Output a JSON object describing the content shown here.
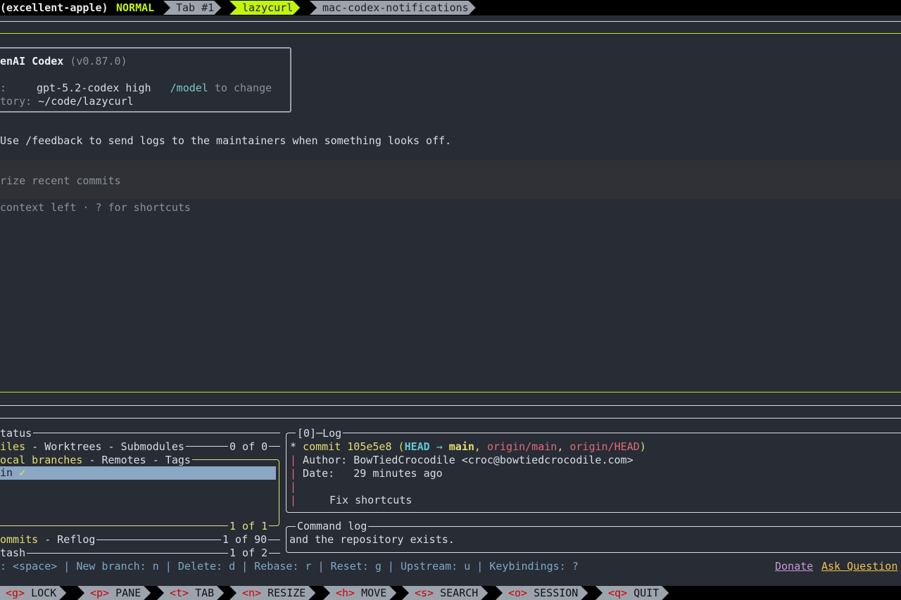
{
  "topbar": {
    "session": "(excellent-apple)",
    "mode": "NORMAL",
    "tabs": [
      {
        "label": "Tab #1",
        "active": false
      },
      {
        "label": "lazycurl",
        "active": true
      },
      {
        "label": "mac-codex-notifications",
        "active": false
      }
    ]
  },
  "codex": {
    "title": "enAI Codex",
    "version": "(v0.87.0)",
    "model_key": ":",
    "model_value": "gpt-5.2-codex high",
    "model_cmd": "/model",
    "model_hint": "to change",
    "dir_key": "tory:",
    "dir_value": "~/code/lazycurl",
    "tip": "Use /feedback to send logs to the maintainers when something looks off.",
    "prompt_placeholder": "rize recent commits",
    "footer": "context left · ? for shortcuts"
  },
  "lazygit": {
    "status_title": "tatus",
    "files_tabs": {
      "active": "iles",
      "rest": " - Worktrees - Submodules"
    },
    "files_count": "0 of 0",
    "branches_tabs": {
      "active": "ocal branches",
      "rest": " - Remotes - Tags"
    },
    "branch_item": "in",
    "branch_check": "✓",
    "branches_count": "1 of 1",
    "commits_tabs": {
      "active": "ommits",
      "rest": " - Reflog"
    },
    "commits_count": "1 of 90",
    "stash_title": "tash",
    "stash_count": "1 of 2",
    "log_title": "[0]─Log",
    "log": {
      "commit_prefix": "* ",
      "commit_word": "commit",
      "hash": "105e5e8",
      "refs_open": "(",
      "head": "HEAD",
      "arrow": " → ",
      "main": "main",
      "origin_main": "origin/main",
      "origin_head": "origin/HEAD",
      "refs_close": ")",
      "author": "Author: BowTiedCrocodile <croc@bowtiedcrocodile.com>",
      "date": "Date:   29 minutes ago",
      "message": "Fix shortcuts"
    },
    "cmdlog_title": "Command log",
    "cmdlog_text": "and the repository exists.",
    "keybind_line": ": <space> | New branch: n | Delete: d | Rebase: r | Reset: g | Upstream: u | Keybindings: ?",
    "donate": "Donate",
    "ask": "Ask Question"
  },
  "bottombar": [
    {
      "key": "<g>",
      "label": " LOCK"
    },
    {
      "key": "<p>",
      "label": " PANE"
    },
    {
      "key": "<t>",
      "label": " TAB"
    },
    {
      "key": "<n>",
      "label": " RESIZE"
    },
    {
      "key": "<h>",
      "label": " MOVE"
    },
    {
      "key": "<s>",
      "label": " SEARCH"
    },
    {
      "key": "<o>",
      "label": " SESSION"
    },
    {
      "key": "<q>",
      "label": " QUIT"
    }
  ],
  "colors": {
    "accent": "#c3f40a",
    "pane_border": "#b8e617",
    "background": "#272c35"
  }
}
